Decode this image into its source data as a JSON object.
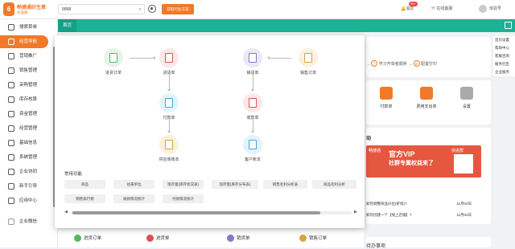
{
  "header": {
    "logo_char": "6",
    "brand_name": "畅捷通好生意",
    "brand_sub": "标准版",
    "account_id": "9998",
    "promo_button": "获取行业方案",
    "message_label": "消息",
    "message_badge": "99+",
    "help_label": "在线客服",
    "user_name": "体验号"
  },
  "sidebar": {
    "items": [
      {
        "label": "搜索菜单"
      },
      {
        "label": "经营导航"
      },
      {
        "label": "营销推广"
      },
      {
        "label": "销售管理"
      },
      {
        "label": "采购管理"
      },
      {
        "label": "库存核算"
      },
      {
        "label": "资金管理"
      },
      {
        "label": "经营管理"
      },
      {
        "label": "基础信息"
      },
      {
        "label": "系统管理"
      },
      {
        "label": "企业协同"
      },
      {
        "label": "新手引导"
      },
      {
        "label": "应用中心"
      },
      {
        "label": "企业微信"
      }
    ]
  },
  "tabs": {
    "home": "首页"
  },
  "flow": {
    "purchase_order": "进货订单",
    "purchase_receipt": "进货单",
    "payment": "付款单",
    "supplier_account": "供应商账本",
    "sales_delivery": "销货单",
    "sales_order": "销售订单",
    "receipt": "收款单",
    "customer_account": "客户账本"
  },
  "common": {
    "title": "常用功能",
    "row1": [
      "商品",
      "往来单位",
      "现存量(库存状况表)",
      "现存量(库存分布表)",
      "销售毛利分析表",
      "商品毛利分析"
    ],
    "row2": [
      "销售排行榜",
      "收款情况统计",
      "付款情况统计"
    ]
  },
  "right": {
    "step_text": "学习开单者顺序",
    "step_num_7": "7",
    "step_num_8": "8",
    "config_print": "配置打印",
    "quick_payment": "付款单",
    "quick_expense": "费用支出单",
    "quick_settings": "设置",
    "dynamic_title": "动",
    "banner_brand": "畅捷通",
    "banner_text1": "官方VIP",
    "banner_text2": "社群专属权益来了",
    "banner_tag": "快进群",
    "news": [
      {
        "text": "如何调整商品价位(折扣)?",
        "date": "11月02日"
      },
      {
        "text": "如何创建一个【线上店铺】?",
        "date": "11月02日"
      }
    ],
    "todo_title": "待办事项"
  },
  "rpanel": [
    "首页设置",
    "帮助中心",
    "客服咨询",
    "服务社区",
    "企业服务"
  ],
  "bottom": {
    "items": [
      "进货订单",
      "进货单",
      "销货单",
      "销售订单"
    ]
  }
}
